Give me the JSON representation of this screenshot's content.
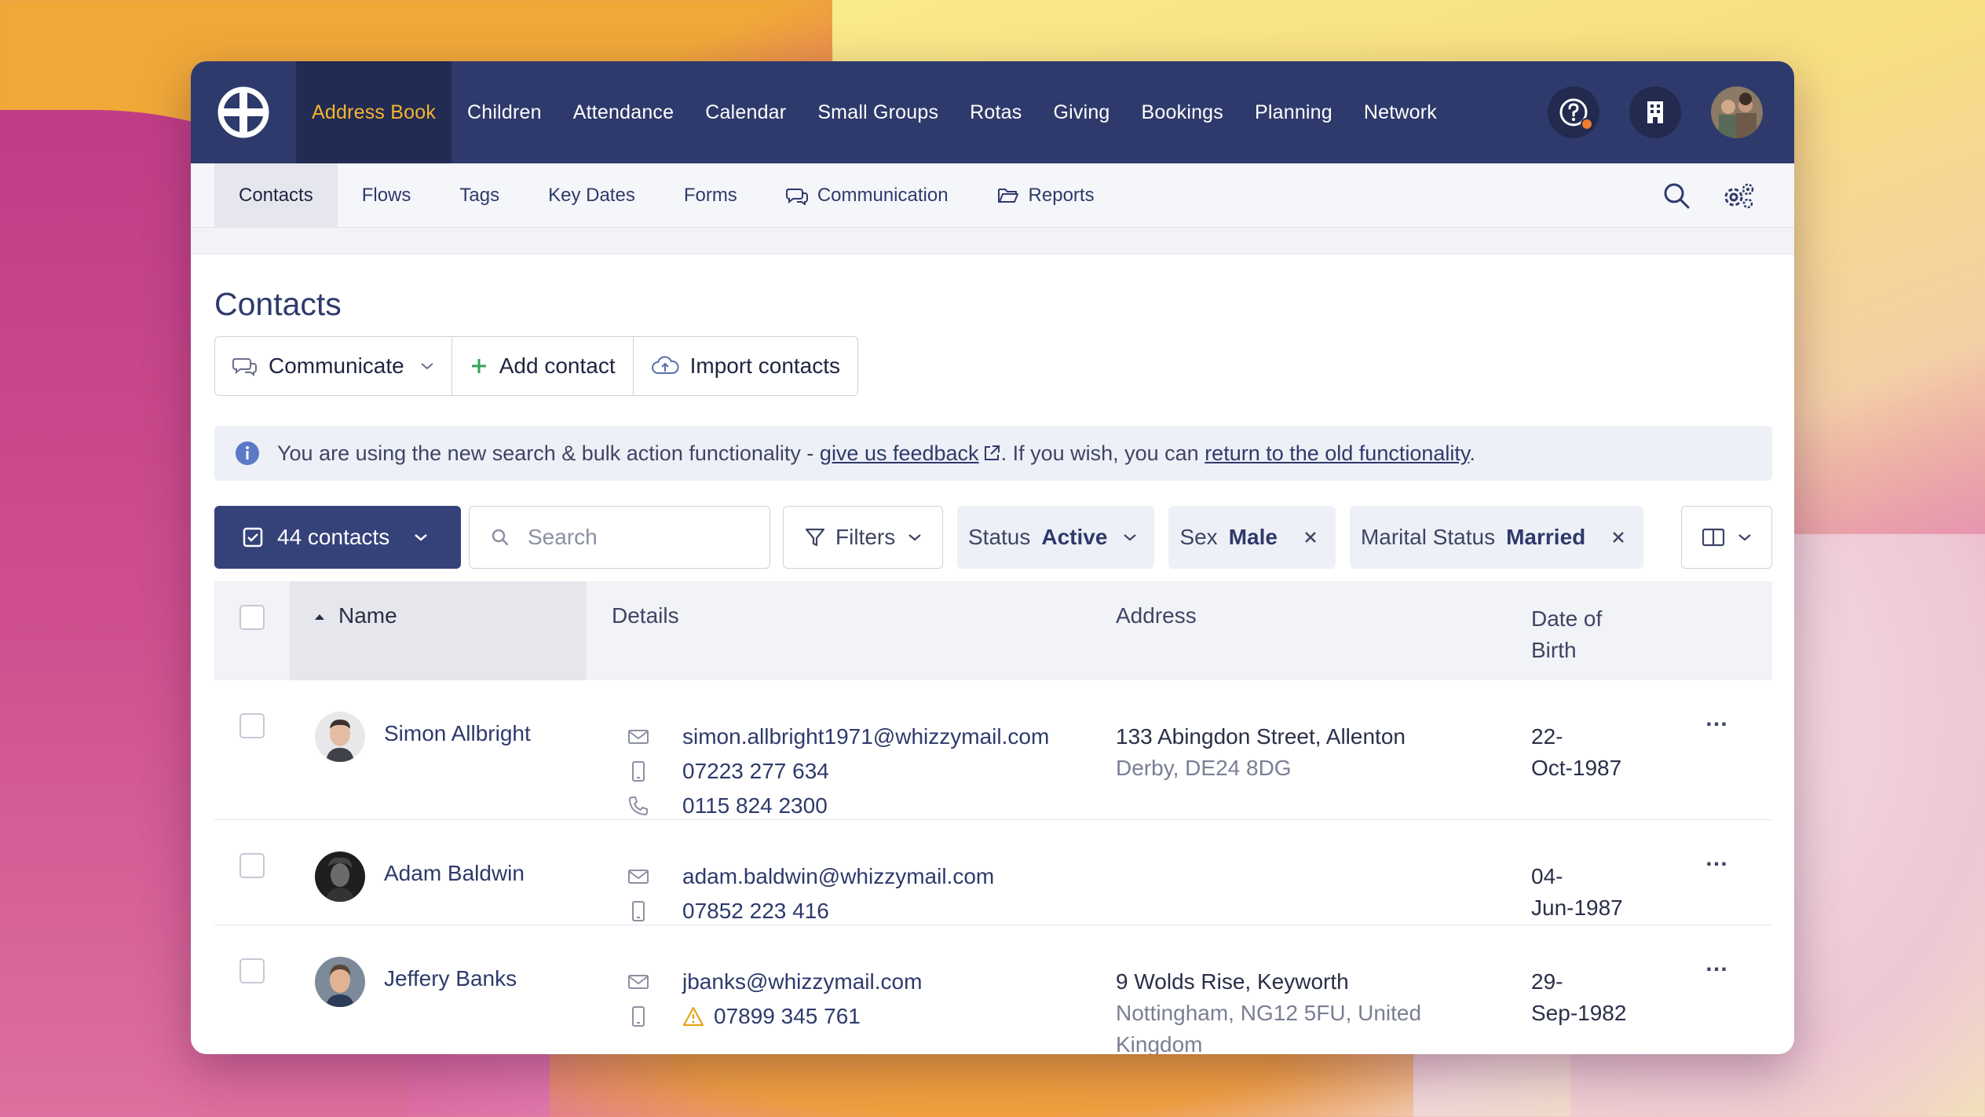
{
  "topnav": {
    "items": [
      {
        "label": "Address Book",
        "active": true
      },
      {
        "label": "Children"
      },
      {
        "label": "Attendance"
      },
      {
        "label": "Calendar"
      },
      {
        "label": "Small Groups"
      },
      {
        "label": "Rotas"
      },
      {
        "label": "Giving"
      },
      {
        "label": "Bookings"
      },
      {
        "label": "Planning"
      },
      {
        "label": "Network"
      }
    ],
    "icons": [
      "help-icon",
      "building-icon",
      "user-avatar"
    ],
    "accent": "#f4b52f",
    "background": "#2e3a6b"
  },
  "subnav": {
    "items": [
      {
        "label": "Contacts",
        "active": true
      },
      {
        "label": "Flows"
      },
      {
        "label": "Tags"
      },
      {
        "label": "Key Dates"
      },
      {
        "label": "Forms"
      },
      {
        "label": "Communication",
        "icon": "chat-icon"
      },
      {
        "label": "Reports",
        "icon": "folder-icon"
      }
    ]
  },
  "page": {
    "title": "Contacts",
    "actions": {
      "communicate": "Communicate",
      "add_contact": "Add contact",
      "import_contacts": "Import contacts"
    }
  },
  "info": {
    "text_before": "You are using the new search & bulk action functionality - ",
    "feedback_link": "give us feedback",
    "text_middle": ". If you wish, you can ",
    "old_link": "return to the old functionality",
    "text_after": "."
  },
  "toolbar": {
    "contacts_count": "44 contacts",
    "search_placeholder": "Search",
    "filters_label": "Filters",
    "chips": [
      {
        "key": "Status",
        "value": "Active",
        "type": "dropdown"
      },
      {
        "key": "Sex",
        "value": "Male",
        "type": "removable"
      },
      {
        "key": "Marital Status",
        "value": "Married",
        "type": "removable"
      }
    ]
  },
  "table": {
    "headers": {
      "name": "Name",
      "details": "Details",
      "address": "Address",
      "dob_line1": "Date of",
      "dob_line2": "Birth"
    },
    "rows": [
      {
        "name": "Simon Allbright",
        "email": "simon.allbright1971@whizzymail.com",
        "mobile": "07223 277 634",
        "phone": "0115 824 2300",
        "address_line1": "133 Abingdon Street, Allenton",
        "address_line2": "Derby, DE24 8DG",
        "dob_line1": "22-",
        "dob_line2": "Oct-1987"
      },
      {
        "name": "Adam Baldwin",
        "email": "adam.baldwin@whizzymail.com",
        "mobile": "07852 223 416",
        "dob_line1": "04-",
        "dob_line2": "Jun-1987"
      },
      {
        "name": "Jeffery Banks",
        "email": "jbanks@whizzymail.com",
        "mobile": "07899 345 761",
        "mobile_warning": true,
        "address_line1": "9 Wolds Rise, Keyworth",
        "address_line2": "Nottingham, NG12 5FU, United",
        "address_line3": "Kingdom",
        "dob_line1": "29-",
        "dob_line2": "Sep-1982"
      }
    ],
    "more_label": "…"
  }
}
